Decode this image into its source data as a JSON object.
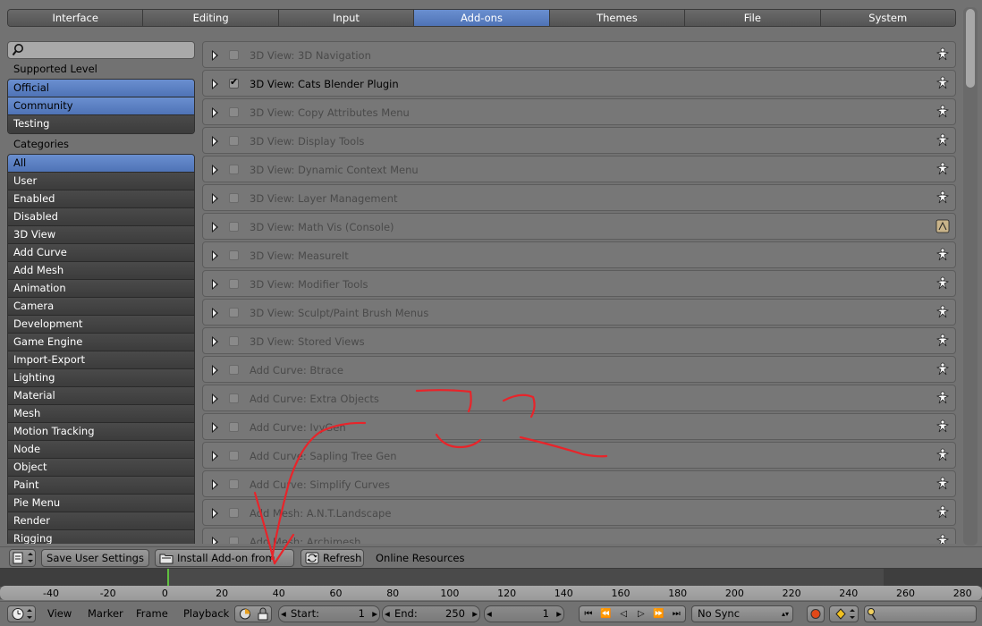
{
  "tabs": [
    "Interface",
    "Editing",
    "Input",
    "Add-ons",
    "Themes",
    "File",
    "System"
  ],
  "active_tab": "Add-ons",
  "sidebar": {
    "search_value": "",
    "supported_level_label": "Supported Level",
    "support_levels": [
      {
        "label": "Official",
        "selected": true
      },
      {
        "label": "Community",
        "selected": true
      },
      {
        "label": "Testing",
        "selected": false
      }
    ],
    "categories_label": "Categories",
    "categories": [
      {
        "label": "All",
        "selected": true
      },
      {
        "label": "User"
      },
      {
        "label": "Enabled"
      },
      {
        "label": "Disabled"
      },
      {
        "label": "3D View"
      },
      {
        "label": "Add Curve"
      },
      {
        "label": "Add Mesh"
      },
      {
        "label": "Animation"
      },
      {
        "label": "Camera"
      },
      {
        "label": "Development"
      },
      {
        "label": "Game Engine"
      },
      {
        "label": "Import-Export"
      },
      {
        "label": "Lighting"
      },
      {
        "label": "Material"
      },
      {
        "label": "Mesh"
      },
      {
        "label": "Motion Tracking"
      },
      {
        "label": "Node"
      },
      {
        "label": "Object"
      },
      {
        "label": "Paint"
      },
      {
        "label": "Pie Menu"
      },
      {
        "label": "Render"
      },
      {
        "label": "Rigging"
      }
    ]
  },
  "addons": [
    {
      "name": "3D View: 3D Navigation",
      "enabled": false,
      "icon": "community-icon"
    },
    {
      "name": "3D View: Cats Blender Plugin",
      "enabled": true,
      "icon": "community-icon"
    },
    {
      "name": "3D View: Copy Attributes Menu",
      "enabled": false,
      "icon": "community-icon"
    },
    {
      "name": "3D View: Display Tools",
      "enabled": false,
      "icon": "community-icon"
    },
    {
      "name": "3D View: Dynamic Context Menu",
      "enabled": false,
      "icon": "community-icon"
    },
    {
      "name": "3D View: Layer Management",
      "enabled": false,
      "icon": "community-icon"
    },
    {
      "name": "3D View: Math Vis (Console)",
      "enabled": false,
      "icon": "official-icon"
    },
    {
      "name": "3D View: MeasureIt",
      "enabled": false,
      "icon": "community-icon"
    },
    {
      "name": "3D View: Modifier Tools",
      "enabled": false,
      "icon": "community-icon"
    },
    {
      "name": "3D View: Sculpt/Paint Brush Menus",
      "enabled": false,
      "icon": "community-icon"
    },
    {
      "name": "3D View: Stored Views",
      "enabled": false,
      "icon": "community-icon"
    },
    {
      "name": "Add Curve: Btrace",
      "enabled": false,
      "icon": "community-icon"
    },
    {
      "name": "Add Curve: Extra Objects",
      "enabled": false,
      "icon": "community-icon"
    },
    {
      "name": "Add Curve: IvyGen",
      "enabled": false,
      "icon": "community-icon"
    },
    {
      "name": "Add Curve: Sapling Tree Gen",
      "enabled": false,
      "icon": "community-icon"
    },
    {
      "name": "Add Curve: Simplify Curves",
      "enabled": false,
      "icon": "community-icon"
    },
    {
      "name": "Add Mesh: A.N.T.Landscape",
      "enabled": false,
      "icon": "community-icon"
    },
    {
      "name": "Add Mesh: Archimesh",
      "enabled": false,
      "icon": "community-icon"
    }
  ],
  "bottombar": {
    "save_label": "Save User Settings",
    "install_label": "Install Add-on from File...",
    "refresh_label": "Refresh",
    "online_label": "Online Resources"
  },
  "timeline": {
    "ticks": [
      "-40",
      "-20",
      "0",
      "20",
      "40",
      "60",
      "80",
      "100",
      "120",
      "140",
      "160",
      "180",
      "200",
      "220",
      "240",
      "260",
      "280"
    ],
    "current_frame": 1
  },
  "footer": {
    "view": "View",
    "marker": "Marker",
    "frame": "Frame",
    "playback": "Playback",
    "start_label": "Start:",
    "start_value": "1",
    "end_label": "End:",
    "end_value": "250",
    "frame_value": "1",
    "sync": "No Sync"
  },
  "colors": {
    "accent": "#5b80c4",
    "annotation": "#e8242a"
  }
}
